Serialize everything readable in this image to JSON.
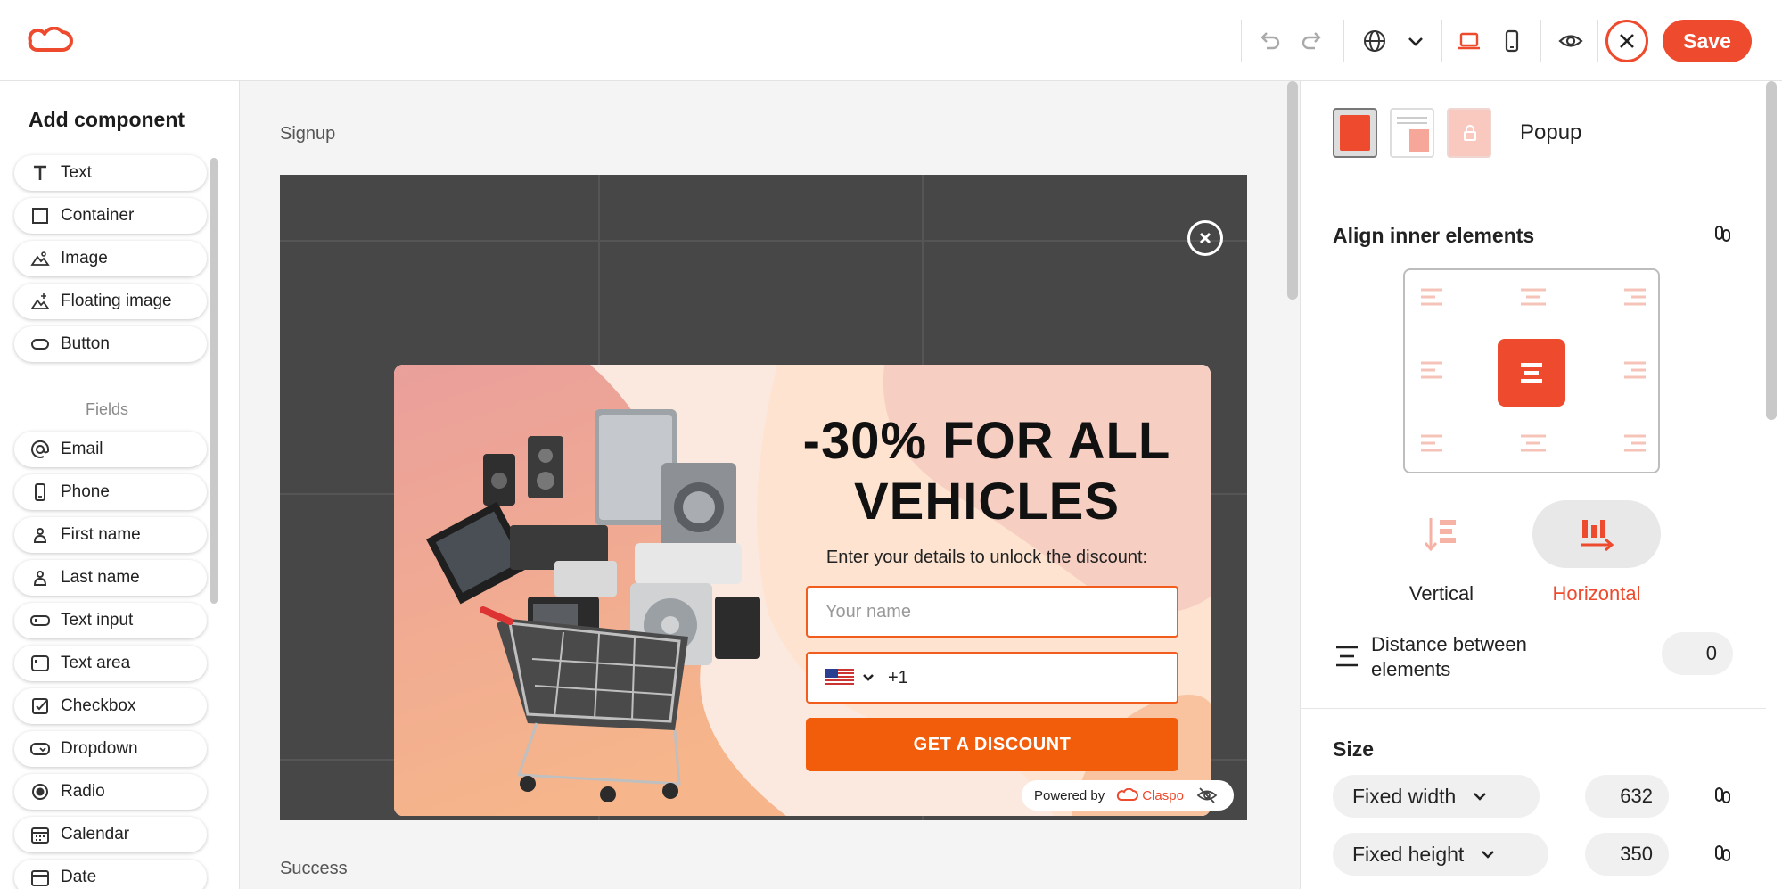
{
  "topbar": {
    "save_label": "Save",
    "icons": [
      "logo-cloud-icon",
      "undo-icon",
      "redo-icon",
      "globe-icon",
      "chevron-down-icon",
      "desktop-icon",
      "mobile-icon",
      "eye-icon",
      "close-icon"
    ],
    "accent_color": "#ee4a2e"
  },
  "left_panel": {
    "title": "Add component",
    "components": [
      {
        "label": "Text",
        "icon": "text-icon"
      },
      {
        "label": "Container",
        "icon": "square-icon"
      },
      {
        "label": "Image",
        "icon": "image-icon"
      },
      {
        "label": "Floating image",
        "icon": "floating-image-icon"
      },
      {
        "label": "Button",
        "icon": "button-icon"
      }
    ],
    "fields_title": "Fields",
    "fields": [
      {
        "label": "Email",
        "icon": "at-icon"
      },
      {
        "label": "Phone",
        "icon": "phone-icon"
      },
      {
        "label": "First name",
        "icon": "person-icon"
      },
      {
        "label": "Last name",
        "icon": "person-icon"
      },
      {
        "label": "Text input",
        "icon": "text-input-icon"
      },
      {
        "label": "Text area",
        "icon": "text-area-icon"
      },
      {
        "label": "Checkbox",
        "icon": "checkbox-icon"
      },
      {
        "label": "Dropdown",
        "icon": "dropdown-icon"
      },
      {
        "label": "Radio",
        "icon": "radio-icon"
      },
      {
        "label": "Calendar",
        "icon": "calendar-icon"
      },
      {
        "label": "Date",
        "icon": "date-icon"
      }
    ]
  },
  "canvas": {
    "section_signup": "Signup",
    "section_success": "Success",
    "popup": {
      "headline_line1": "-30% FOR ALL",
      "headline_line2": "VEHICLES",
      "subtitle": "Enter your details to unlock the discount:",
      "name_placeholder": "Your name",
      "phone_code": "+1",
      "cta_label": "GET A DISCOUNT"
    },
    "powered_by": "Powered by",
    "brand": "Claspo"
  },
  "right_panel": {
    "popup_type": "Popup",
    "align_title": "Align inner elements",
    "direction_vertical": "Vertical",
    "direction_horizontal": "Horizontal",
    "distance_label": "Distance between elements",
    "distance_value": "0",
    "size_title": "Size",
    "width_mode": "Fixed width",
    "width_value": "632",
    "height_mode": "Fixed height",
    "height_value": "350"
  }
}
